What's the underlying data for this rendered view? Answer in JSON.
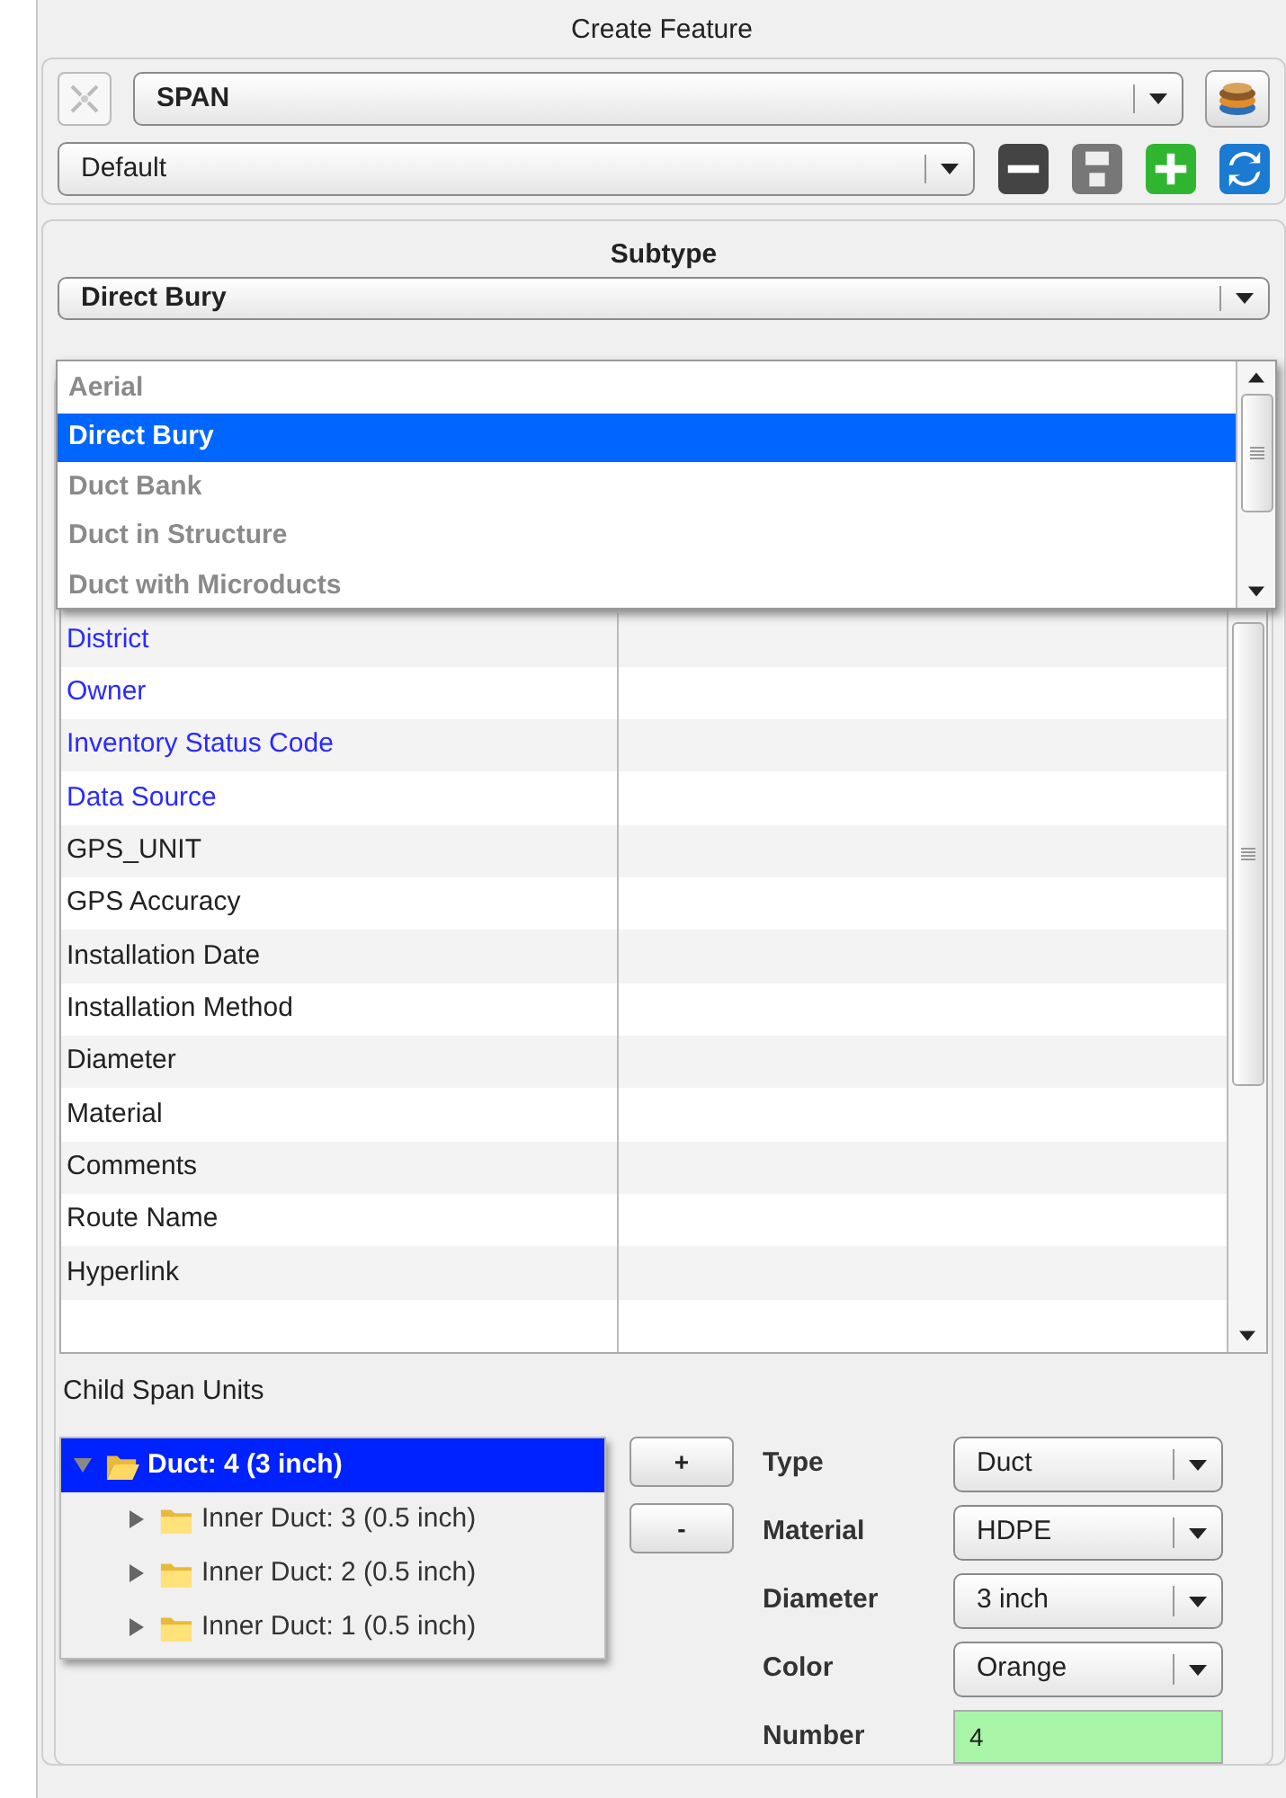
{
  "title": "Create Feature",
  "feature_class": {
    "value": "SPAN"
  },
  "template": {
    "value": "Default"
  },
  "subtype": {
    "heading": "Subtype",
    "value": "Direct Bury"
  },
  "subtype_options": [
    {
      "label": "Aerial",
      "selected": false
    },
    {
      "label": "Direct Bury",
      "selected": true
    },
    {
      "label": "Duct Bank",
      "selected": false
    },
    {
      "label": "Duct in Structure",
      "selected": false
    },
    {
      "label": "Duct with Microducts",
      "selected": false
    }
  ],
  "attributes": [
    {
      "name": "District",
      "required": true
    },
    {
      "name": "Owner",
      "required": true
    },
    {
      "name": "Inventory Status Code",
      "required": true
    },
    {
      "name": "Data Source",
      "required": true
    },
    {
      "name": "GPS_UNIT",
      "required": false
    },
    {
      "name": "GPS Accuracy",
      "required": false
    },
    {
      "name": "Installation Date",
      "required": false
    },
    {
      "name": "Installation Method",
      "required": false
    },
    {
      "name": "Diameter",
      "required": false
    },
    {
      "name": "Material",
      "required": false
    },
    {
      "name": "Comments",
      "required": false
    },
    {
      "name": "Route Name",
      "required": false
    },
    {
      "name": "Hyperlink",
      "required": false
    }
  ],
  "child_span_units": {
    "label": "Child Span Units",
    "tree": [
      {
        "label": "Duct: 4 (3 inch)",
        "selected": true,
        "expanded": true,
        "children": [
          {
            "label": "Inner Duct: 3 (0.5 inch)",
            "selected": false,
            "expanded": false
          },
          {
            "label": "Inner Duct: 2 (0.5 inch)",
            "selected": false,
            "expanded": false
          },
          {
            "label": "Inner Duct: 1 (0.5 inch)",
            "selected": false,
            "expanded": false
          }
        ]
      }
    ],
    "buttons": [
      "+",
      "-"
    ],
    "fields": [
      {
        "kind": "select",
        "label": "Type",
        "value": "Duct"
      },
      {
        "kind": "select",
        "label": "Material",
        "value": "HDPE"
      },
      {
        "kind": "select",
        "label": "Diameter",
        "value": "3 inch"
      },
      {
        "kind": "select",
        "label": "Color",
        "value": "Orange"
      },
      {
        "kind": "input",
        "label": "Number",
        "value": "4"
      }
    ]
  }
}
